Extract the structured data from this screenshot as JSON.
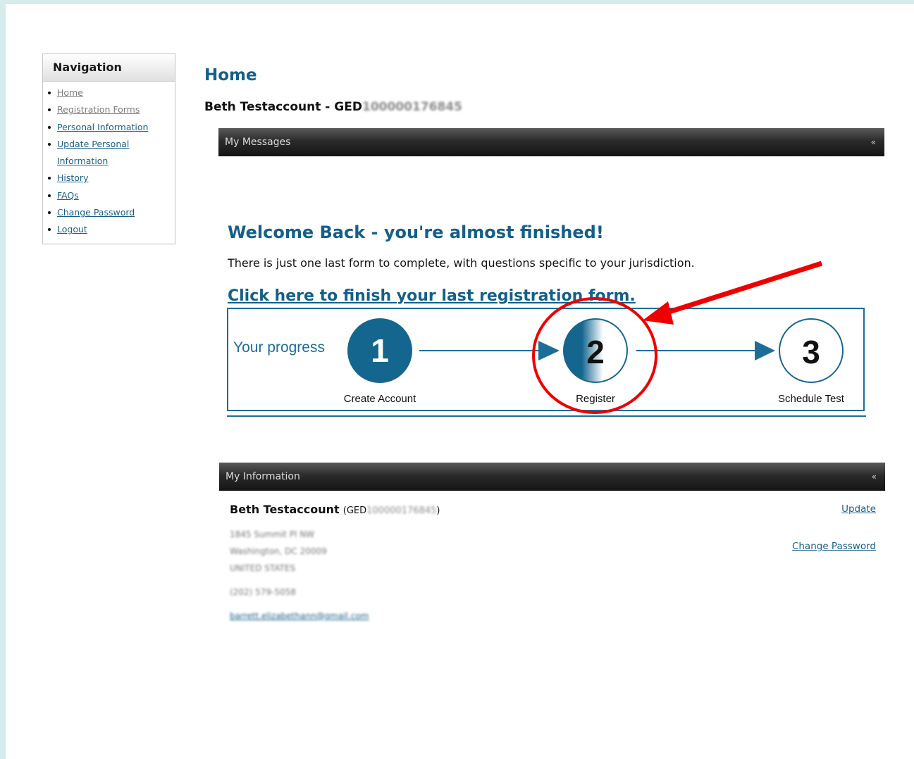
{
  "nav": {
    "title": "Navigation",
    "items": [
      {
        "label": "Home",
        "muted": true
      },
      {
        "label": "Registration Forms",
        "muted": true
      },
      {
        "label": "Personal Information",
        "muted": false
      },
      {
        "label": "Update Personal Information",
        "muted": false
      },
      {
        "label": "History",
        "muted": false
      },
      {
        "label": "FAQs",
        "muted": false
      },
      {
        "label": "Change Password",
        "muted": false
      },
      {
        "label": "Logout",
        "muted": false
      }
    ]
  },
  "header": {
    "title": "Home",
    "user_name": "Beth Testaccount",
    "separator": " - ",
    "id_prefix": "GED",
    "id_number": "100000176845"
  },
  "messages": {
    "bar_label": "My Messages",
    "collapse_glyph": "«"
  },
  "welcome": {
    "heading": "Welcome Back - you're almost finished!",
    "intro": "There is just one last form to complete, with questions specific to your jurisdiction.",
    "link": "Click here to finish your last registration form."
  },
  "progress": {
    "label": "Your progress",
    "current_step": 2,
    "steps": [
      {
        "number": "1",
        "label": "Create Account"
      },
      {
        "number": "2",
        "label": "Register"
      },
      {
        "number": "3",
        "label": "Schedule Test"
      }
    ]
  },
  "info": {
    "bar_label": "My Information",
    "collapse_glyph": "«",
    "name": "Beth Testaccount",
    "id_open": "(GED",
    "id_number": "100000176845",
    "id_close": ")",
    "address_line1": "1845 Summit Pl NW",
    "address_line2": "Washington, DC 20009",
    "address_line3": "UNITED STATES",
    "phone": "(202) 579-5058",
    "email": "barrett.elizabethann@gmail.com",
    "update_label": "Update",
    "change_password_label": "Change Password"
  },
  "colors": {
    "brand_blue": "#145f89",
    "annotation_red": "#ee0000",
    "page_bg": "#d6ecec"
  }
}
